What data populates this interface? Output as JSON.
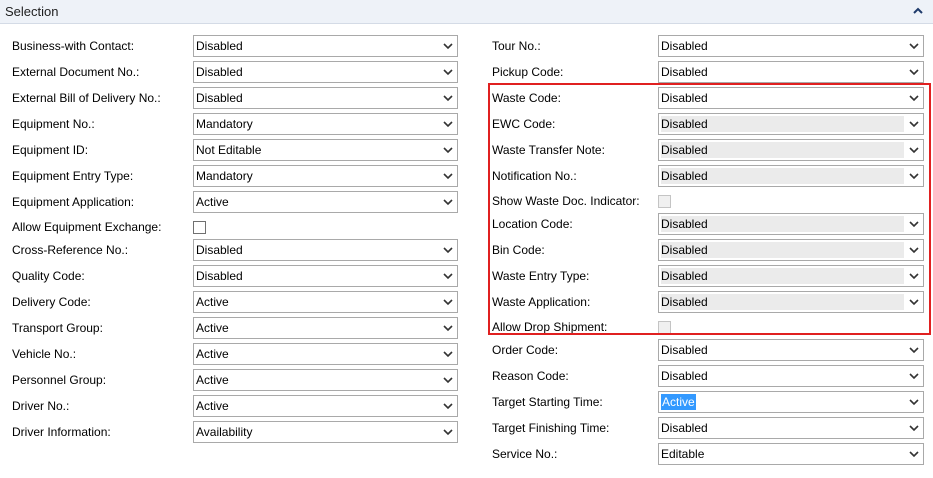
{
  "section": {
    "title": "Selection"
  },
  "left_fields": [
    {
      "label": "Business-with Contact:",
      "type": "select",
      "value": "Disabled"
    },
    {
      "label": "External Document No.:",
      "type": "select",
      "value": "Disabled"
    },
    {
      "label": "External Bill of Delivery No.:",
      "type": "select",
      "value": "Disabled"
    },
    {
      "label": "Equipment No.:",
      "type": "select",
      "value": "Mandatory"
    },
    {
      "label": "Equipment ID:",
      "type": "select",
      "value": "Not Editable"
    },
    {
      "label": "Equipment Entry Type:",
      "type": "select",
      "value": "Mandatory"
    },
    {
      "label": "Equipment Application:",
      "type": "select",
      "value": "Active"
    },
    {
      "label": "Allow Equipment Exchange:",
      "type": "checkbox",
      "checked": false
    },
    {
      "label": "Cross-Reference No.:",
      "type": "select",
      "value": "Disabled"
    },
    {
      "label": "Quality Code:",
      "type": "select",
      "value": "Disabled"
    },
    {
      "label": "Delivery Code:",
      "type": "select",
      "value": "Active"
    },
    {
      "label": "Transport Group:",
      "type": "select",
      "value": "Active"
    },
    {
      "label": "Vehicle No.:",
      "type": "select",
      "value": "Active"
    },
    {
      "label": "Personnel Group:",
      "type": "select",
      "value": "Active"
    },
    {
      "label": "Driver No.:",
      "type": "select",
      "value": "Active"
    },
    {
      "label": "Driver Information:",
      "type": "select",
      "value": "Availability"
    }
  ],
  "right_fields": [
    {
      "label": "Tour No.:",
      "type": "select",
      "value": "Disabled"
    },
    {
      "label": "Pickup Code:",
      "type": "select",
      "value": "Disabled"
    },
    {
      "label": "Waste Code:",
      "type": "select",
      "value": "Disabled"
    },
    {
      "label": "EWC Code:",
      "type": "select",
      "value": "Disabled",
      "readonly": true
    },
    {
      "label": "Waste Transfer Note:",
      "type": "select",
      "value": "Disabled",
      "readonly": true
    },
    {
      "label": "Notification No.:",
      "type": "select",
      "value": "Disabled",
      "readonly": true
    },
    {
      "label": "Show Waste Doc. Indicator:",
      "type": "checkbox",
      "checked": false,
      "readonly": true
    },
    {
      "label": "Location Code:",
      "type": "select",
      "value": "Disabled",
      "readonly": true
    },
    {
      "label": "Bin Code:",
      "type": "select",
      "value": "Disabled",
      "readonly": true
    },
    {
      "label": "Waste Entry Type:",
      "type": "select",
      "value": "Disabled",
      "readonly": true
    },
    {
      "label": "Waste Application:",
      "type": "select",
      "value": "Disabled",
      "readonly": true
    },
    {
      "label": "Allow Drop Shipment:",
      "type": "checkbox",
      "checked": false,
      "readonly": true
    },
    {
      "label": "Order Code:",
      "type": "select",
      "value": "Disabled"
    },
    {
      "label": "Reason Code:",
      "type": "select",
      "value": "Disabled"
    },
    {
      "label": "Target Starting Time:",
      "type": "select",
      "value": "Active",
      "selected": true
    },
    {
      "label": "Target Finishing Time:",
      "type": "select",
      "value": "Disabled"
    },
    {
      "label": "Service No.:",
      "type": "select",
      "value": "Editable"
    }
  ],
  "icons": {
    "collapse": "chevron-up-icon",
    "dropdown": "chevron-down-icon"
  },
  "colors": {
    "highlight_frame": "#e02020",
    "selection": "#3399ff",
    "header_bg": "#eef2f8"
  }
}
